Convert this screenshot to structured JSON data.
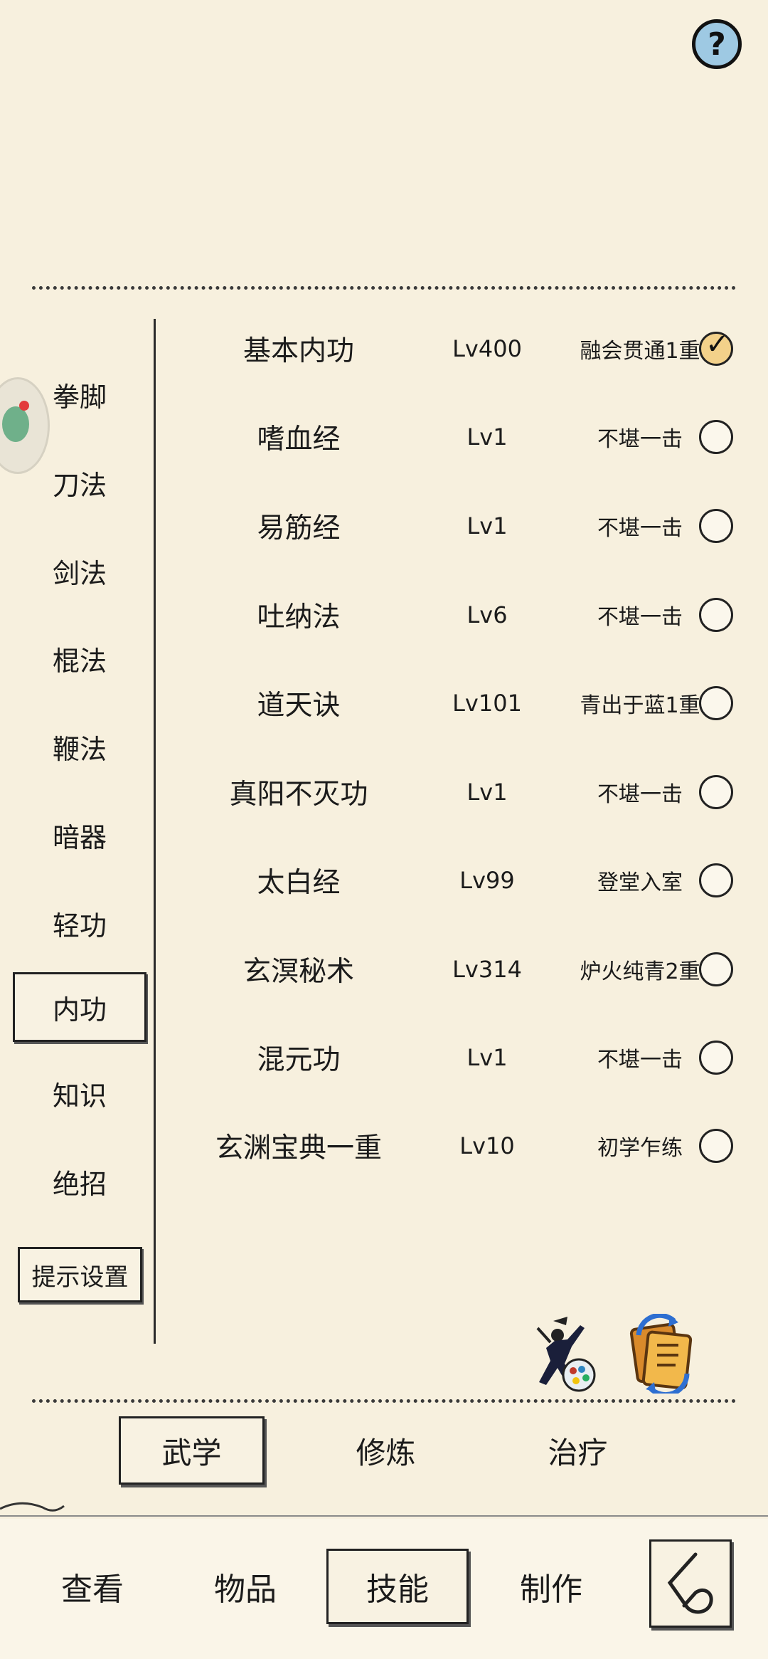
{
  "help": {
    "label": "?"
  },
  "categories": [
    {
      "label": "拳脚"
    },
    {
      "label": "刀法"
    },
    {
      "label": "剑法"
    },
    {
      "label": "棍法"
    },
    {
      "label": "鞭法"
    },
    {
      "label": "暗器"
    },
    {
      "label": "轻功"
    },
    {
      "label": "内功"
    },
    {
      "label": "知识"
    },
    {
      "label": "绝招"
    }
  ],
  "selected_category": "内功",
  "tip_settings_label": "提示设置",
  "skills": [
    {
      "name": "基本内功",
      "level": "Lv400",
      "rank": "融会贯通1重",
      "equipped": true
    },
    {
      "name": "嗜血经",
      "level": "Lv1",
      "rank": "不堪一击",
      "equipped": false
    },
    {
      "name": "易筋经",
      "level": "Lv1",
      "rank": "不堪一击",
      "equipped": false
    },
    {
      "name": "吐纳法",
      "level": "Lv6",
      "rank": "不堪一击",
      "equipped": false
    },
    {
      "name": "道天诀",
      "level": "Lv101",
      "rank": "青出于蓝1重",
      "equipped": false
    },
    {
      "name": "真阳不灭功",
      "level": "Lv1",
      "rank": "不堪一击",
      "equipped": false
    },
    {
      "name": "太白经",
      "level": "Lv99",
      "rank": "登堂入室",
      "equipped": false
    },
    {
      "name": "玄溟秘术",
      "level": "Lv314",
      "rank": "炉火纯青2重",
      "equipped": false
    },
    {
      "name": "混元功",
      "level": "Lv1",
      "rank": "不堪一击",
      "equipped": false
    },
    {
      "name": "玄渊宝典一重",
      "level": "Lv10",
      "rank": "初学乍练",
      "equipped": false
    }
  ],
  "sub_tabs": [
    {
      "label": "武学",
      "selected": true
    },
    {
      "label": "修炼",
      "selected": false
    },
    {
      "label": "治疗",
      "selected": false
    }
  ],
  "bottom_tabs": [
    {
      "label": "查看",
      "selected": false
    },
    {
      "label": "物品",
      "selected": false
    },
    {
      "label": "技能",
      "selected": true
    },
    {
      "label": "制作",
      "selected": false
    }
  ],
  "colors": {
    "background": "#f7f0de",
    "help_button": "#9ec9e3",
    "checked_radio": "#f3d18a"
  }
}
